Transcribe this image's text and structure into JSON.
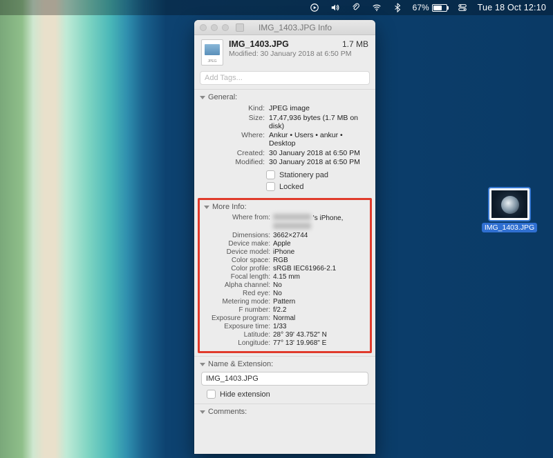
{
  "menubar": {
    "battery_pct": "67%",
    "battery_fill_pct": 67,
    "datetime": "Tue 18 Oct  12:10"
  },
  "window": {
    "title": "IMG_1403.JPG Info",
    "header": {
      "filename": "IMG_1403.JPG",
      "filesize": "1.7 MB",
      "modified_line": "Modified: 30 January 2018 at 6:50 PM"
    },
    "tags_placeholder": "Add Tags...",
    "sections": {
      "general": {
        "label": "General:",
        "rows": [
          {
            "k": "Kind:",
            "v": "JPEG image"
          },
          {
            "k": "Size:",
            "v": "17,47,936 bytes (1.7 MB on disk)"
          },
          {
            "k": "Where:",
            "v": "Ankur • Users • ankur • Desktop"
          },
          {
            "k": "Created:",
            "v": "30 January 2018 at 6:50 PM"
          },
          {
            "k": "Modified:",
            "v": "30 January 2018 at 6:50 PM"
          }
        ],
        "checks": [
          {
            "label": "Stationery pad"
          },
          {
            "label": "Locked"
          }
        ]
      },
      "more_info": {
        "label": "More Info:",
        "where_from_label": "Where from:",
        "where_from_suffix": "'s iPhone,",
        "rows": [
          {
            "k": "Dimensions:",
            "v": "3662×2744"
          },
          {
            "k": "Device make:",
            "v": "Apple"
          },
          {
            "k": "Device model:",
            "v": "iPhone"
          },
          {
            "k": "Color space:",
            "v": "RGB"
          },
          {
            "k": "Color profile:",
            "v": "sRGB IEC61966-2.1"
          },
          {
            "k": "Focal length:",
            "v": "4.15 mm"
          },
          {
            "k": "Alpha channel:",
            "v": "No"
          },
          {
            "k": "Red eye:",
            "v": "No"
          },
          {
            "k": "Metering mode:",
            "v": "Pattern"
          },
          {
            "k": "F number:",
            "v": "f/2.2"
          },
          {
            "k": "Exposure program:",
            "v": "Normal"
          },
          {
            "k": "Exposure time:",
            "v": "1/33"
          },
          {
            "k": "Latitude:",
            "v": "28° 39' 43.752\" N"
          },
          {
            "k": "Longitude:",
            "v": "77° 13' 19.968\" E"
          }
        ]
      },
      "name_ext": {
        "label": "Name & Extension:",
        "value": "IMG_1403.JPG",
        "hide_ext_label": "Hide extension"
      },
      "comments": {
        "label": "Comments:"
      }
    }
  },
  "desktop_file": {
    "label": "IMG_1403.JPG"
  }
}
